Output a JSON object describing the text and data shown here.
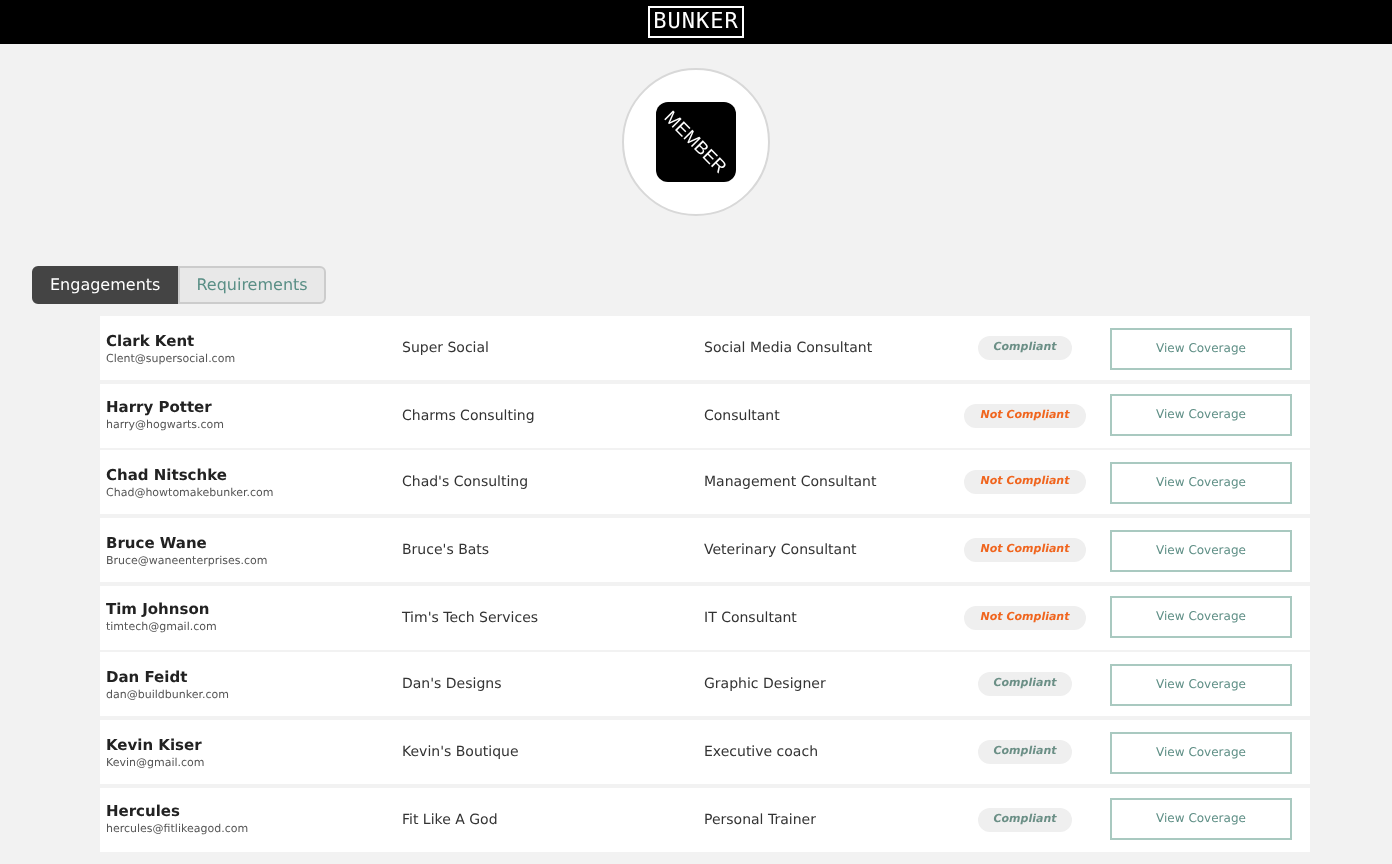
{
  "header": {
    "logo": "BUNKER"
  },
  "badge": {
    "label": "MEMBER"
  },
  "tabs": [
    {
      "label": "Engagements",
      "selected": true
    },
    {
      "label": "Requirements",
      "selected": false
    }
  ],
  "rows": [
    {
      "name": "Clark Kent",
      "email": "Clent@supersocial.com",
      "company": "Super Social",
      "role": "Social Media Consultant",
      "status": "Compliant",
      "kind": "compliant",
      "action": "View Coverage"
    },
    {
      "name": "Harry Potter",
      "email": "harry@hogwarts.com",
      "company": "Charms Consulting",
      "role": "Consultant",
      "status": "Not Compliant",
      "kind": "not_compliant",
      "action": "View Coverage"
    },
    {
      "name": "Chad Nitschke",
      "email": "Chad@howtomakebunker.com",
      "company": "Chad's Consulting",
      "role": "Management Consultant",
      "status": "Not Compliant",
      "kind": "not_compliant",
      "action": "View Coverage"
    },
    {
      "name": "Bruce Wane",
      "email": "Bruce@waneenterprises.com",
      "company": "Bruce's Bats",
      "role": "Veterinary Consultant",
      "status": "Not Compliant",
      "kind": "not_compliant",
      "action": "View Coverage"
    },
    {
      "name": "Tim Johnson",
      "email": "timtech@gmail.com",
      "company": "Tim's Tech Services",
      "role": "IT Consultant",
      "status": "Not Compliant",
      "kind": "not_compliant",
      "action": "View Coverage"
    },
    {
      "name": "Dan Feidt",
      "email": "dan@buildbunker.com",
      "company": "Dan's Designs",
      "role": "Graphic Designer",
      "status": "Compliant",
      "kind": "compliant",
      "action": "View Coverage"
    },
    {
      "name": "Kevin Kiser",
      "email": "Kevin@gmail.com",
      "company": "Kevin's Boutique",
      "role": "Executive coach",
      "status": "Compliant",
      "kind": "compliant",
      "action": "View Coverage"
    },
    {
      "name": "Hercules",
      "email": "hercules@fitlikeagod.com",
      "company": "Fit Like A God",
      "role": "Personal Trainer",
      "status": "Compliant",
      "kind": "compliant",
      "action": "View Coverage"
    }
  ]
}
